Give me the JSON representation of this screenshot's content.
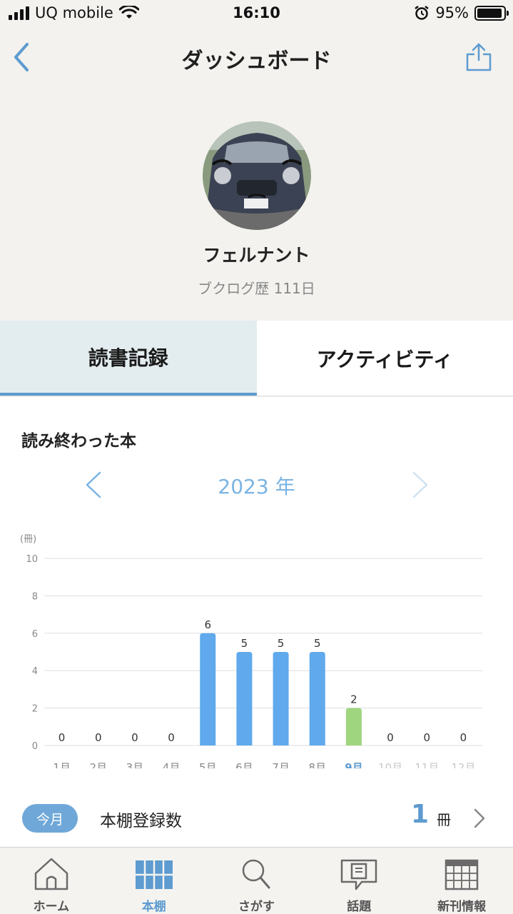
{
  "status_bar": {
    "carrier": "UQ mobile",
    "time": "16:10",
    "battery": "95%",
    "battery_level": 0.95
  },
  "nav": {
    "title": "ダッシュボード",
    "back_icon": "chevron-left-icon",
    "share_icon": "share-icon"
  },
  "profile": {
    "name": "フェルナント",
    "history": "ブクログ歴 111日"
  },
  "tabs": [
    {
      "label": "読書記録",
      "active": true
    },
    {
      "label": "アクティビティ",
      "active": false
    }
  ],
  "section": {
    "title": "読み終わった本"
  },
  "year_nav": {
    "label": "2023 年"
  },
  "chart_data": {
    "type": "bar",
    "unit_label": "(冊)",
    "categories": [
      "1月",
      "2月",
      "3月",
      "4月",
      "5月",
      "6月",
      "7月",
      "8月",
      "9月",
      "10月",
      "11月",
      "12月"
    ],
    "values": [
      0,
      0,
      0,
      0,
      6,
      5,
      5,
      5,
      2,
      0,
      0,
      0
    ],
    "current_month": "9月",
    "future_months": [
      "10月",
      "11月",
      "12月"
    ],
    "ylim": [
      0,
      10
    ],
    "yticks": [
      0,
      2,
      4,
      6,
      8,
      10
    ],
    "grid": true,
    "colors": {
      "bar": "#5fa9ec",
      "current_bar": "#9fd57f",
      "current_label": "#5d9bd0",
      "label": "#888888",
      "future_label": "#c8c8c8",
      "grid": "#dddddd"
    }
  },
  "this_month": {
    "badge": "今月",
    "label": "本棚登録数",
    "count": "1",
    "unit": "冊"
  },
  "tabbar": [
    {
      "label": "ホーム",
      "icon": "home-icon",
      "active": false
    },
    {
      "label": "本棚",
      "icon": "bookshelf-icon",
      "active": true
    },
    {
      "label": "さがす",
      "icon": "search-icon",
      "active": false
    },
    {
      "label": "話題",
      "icon": "topic-icon",
      "active": false
    },
    {
      "label": "新刊情報",
      "icon": "calendar-icon",
      "active": false
    }
  ]
}
